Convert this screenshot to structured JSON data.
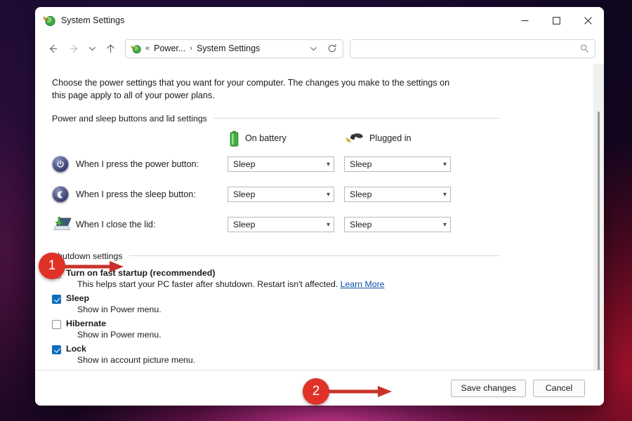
{
  "window": {
    "title": "System Settings",
    "app_icon": "power-plug-icon",
    "controls": {
      "minimize": "minimize-icon",
      "maximize": "maximize-icon",
      "close": "close-icon"
    }
  },
  "nav": {
    "back": "back-arrow-icon",
    "forward": "forward-arrow-icon",
    "recent": "chevron-down-icon",
    "up": "up-arrow-icon",
    "address": {
      "icon": "power-plug-icon",
      "overflow": "«",
      "crumb1": "Power...",
      "separator": "›",
      "crumb2": "System Settings",
      "dropdown": "chevron-down-icon",
      "refresh": "refresh-icon"
    },
    "search": {
      "value": "",
      "placeholder": "",
      "icon": "search-icon"
    }
  },
  "main": {
    "intro": "Choose the power settings that you want for your computer. The changes you make to the settings on this page apply to all of your power plans.",
    "section1_title": "Power and sleep buttons and lid settings",
    "columns": [
      {
        "label": "On battery",
        "icon": "battery-icon"
      },
      {
        "label": "Plugged in",
        "icon": "power-plug-icon"
      }
    ],
    "rows": [
      {
        "icon": "power-button-icon",
        "label": "When I press the power button:",
        "on_battery": "Sleep",
        "plugged_in": "Sleep"
      },
      {
        "icon": "sleep-button-icon",
        "label": "When I press the sleep button:",
        "on_battery": "Sleep",
        "plugged_in": "Sleep"
      },
      {
        "icon": "laptop-lid-icon",
        "label": "When I close the lid:",
        "on_battery": "Sleep",
        "plugged_in": "Sleep"
      }
    ],
    "section2_title": "Shutdown settings",
    "options": [
      {
        "label": "Turn on fast startup (recommended)",
        "checked": false,
        "description": "This helps start your PC faster after shutdown. Restart isn't affected.",
        "link": "Learn More"
      },
      {
        "label": "Sleep",
        "checked": true,
        "description": "Show in Power menu.",
        "link": ""
      },
      {
        "label": "Hibernate",
        "checked": false,
        "description": "Show in Power menu.",
        "link": ""
      },
      {
        "label": "Lock",
        "checked": true,
        "description": "Show in account picture menu.",
        "link": ""
      }
    ]
  },
  "footer": {
    "save_label": "Save changes",
    "cancel_label": "Cancel"
  },
  "annotations": [
    {
      "number": "1",
      "target": "fast-startup-checkbox"
    },
    {
      "number": "2",
      "target": "save-changes-button"
    }
  ],
  "colors": {
    "accent_checkbox": "#0f6cbd",
    "annotation_red": "#e03127",
    "link_blue": "#0b4fa8"
  }
}
